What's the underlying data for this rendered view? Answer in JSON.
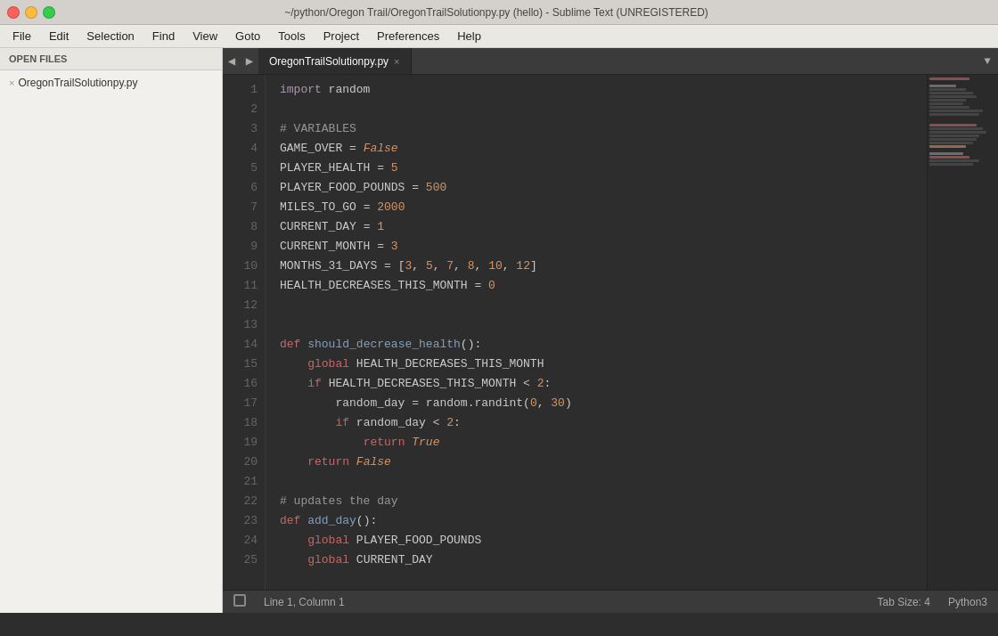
{
  "titlebar": {
    "title": "~/python/Oregon Trail/OregonTrailSolutionpy.py (hello) - Sublime Text (UNREGISTERED)"
  },
  "menubar": {
    "items": [
      "File",
      "Edit",
      "Selection",
      "Find",
      "View",
      "Goto",
      "Tools",
      "Project",
      "Preferences",
      "Help"
    ]
  },
  "sidebar": {
    "header": "OPEN FILES",
    "files": [
      {
        "name": "OregonTrailSolutionpy.py",
        "active": true
      }
    ]
  },
  "tabs": {
    "nav_left": "◀",
    "nav_right": "▶",
    "items": [
      {
        "label": "OregonTrailSolutionpy.py",
        "active": true,
        "close": "×"
      }
    ],
    "dropdown": "▼"
  },
  "statusbar": {
    "left": "Line 1, Column 1",
    "tab_size": "Tab Size: 4",
    "syntax": "Python3"
  }
}
